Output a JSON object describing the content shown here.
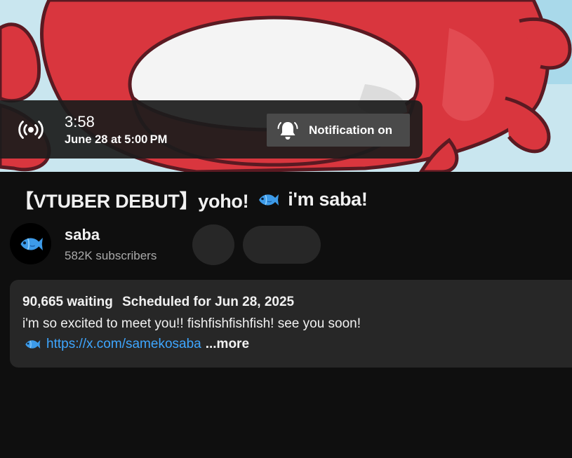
{
  "premiere": {
    "countdown": "3:58",
    "scheduled_time": "June 28 at 5:00 PM",
    "notification_label": "Notification on"
  },
  "video": {
    "title_part1": "【VTUBER DEBUT】yoho!",
    "title_part2": "i'm saba!"
  },
  "channel": {
    "name": "saba",
    "subscribers": "582K subscribers"
  },
  "description": {
    "waiting": "90,665 waiting",
    "scheduled": "Scheduled for Jun 28, 2025",
    "text": "i'm so excited to meet you!! fishfishfishfish! see you soon!",
    "link": "https://x.com/samekosaba",
    "more": "...more"
  },
  "colors": {
    "background": "#0f0f0f",
    "link": "#3ea6ff",
    "surface": "#272727",
    "thumbnail_red": "#d9363e"
  },
  "icons": [
    "live-broadcast-icon",
    "bell-icon",
    "fish-emoji-icon"
  ]
}
